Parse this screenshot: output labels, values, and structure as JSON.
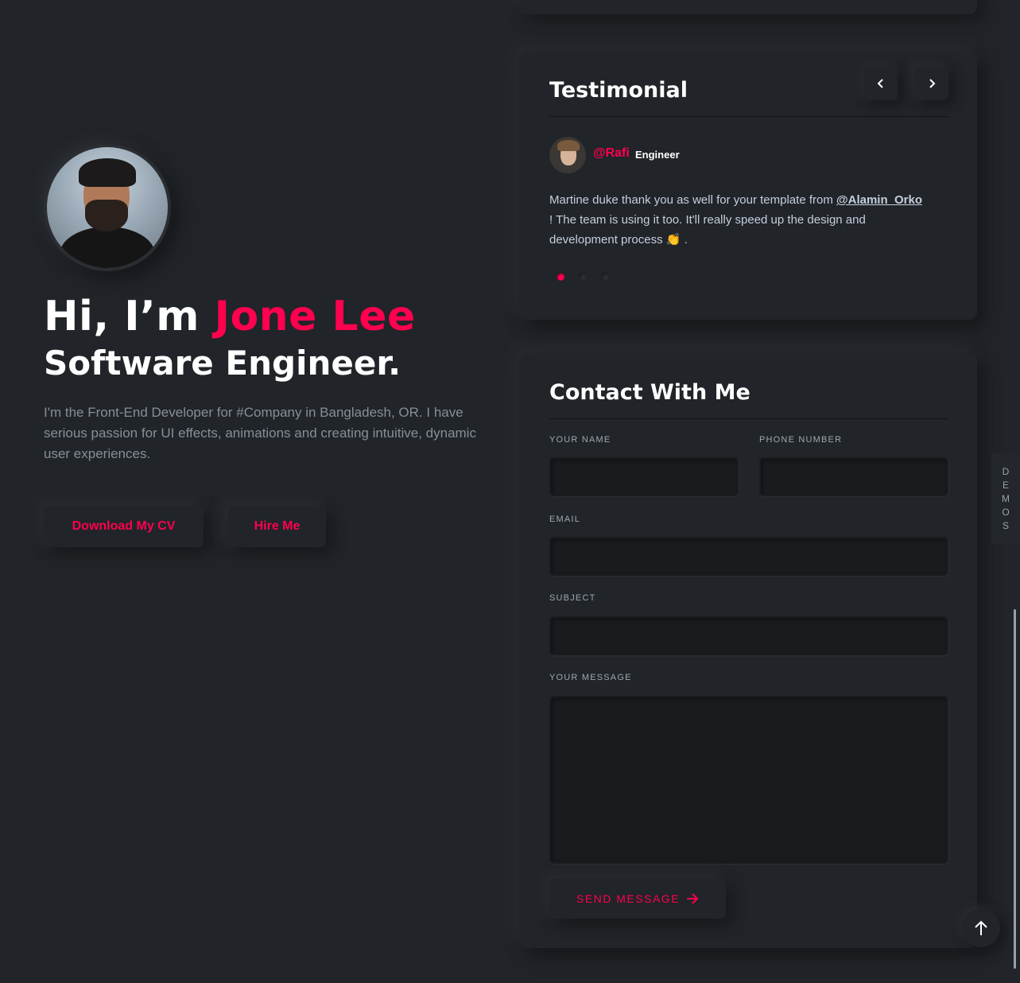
{
  "hero": {
    "greeting": "Hi, I’m ",
    "name": "Jone Lee",
    "role": "Software Engineer.",
    "description": "I'm the Front-End Developer for #Company in Bangladesh, OR. I have serious passion for UI effects, animations and creating intuitive, dynamic user experiences.",
    "btn_cv": "Download My CV",
    "btn_hire": "Hire Me"
  },
  "testimonial": {
    "title": "Testimonial",
    "handle": "@Rafi",
    "role": "Engineer",
    "text_before": "Martine duke thank you as well for your template from ",
    "mention": "@Alamin_Orko",
    "text_after": " ! The team is using it too. It'll really speed up the design and development process ",
    "emoji": "👏",
    "text_end": " .",
    "nav_prev": "‹",
    "nav_next": "›"
  },
  "contact": {
    "title": "Contact With Me",
    "name_label": "YOUR NAME",
    "phone_label": "PHONE NUMBER",
    "email_label": "EMAIL",
    "subject_label": "SUBJECT",
    "message_label": "YOUR MESSAGE",
    "send_label": "SEND MESSAGE"
  },
  "demos": [
    "D",
    "E",
    "M",
    "O",
    "S"
  ],
  "colors": {
    "accent": "#ff014f",
    "background": "#212428"
  }
}
